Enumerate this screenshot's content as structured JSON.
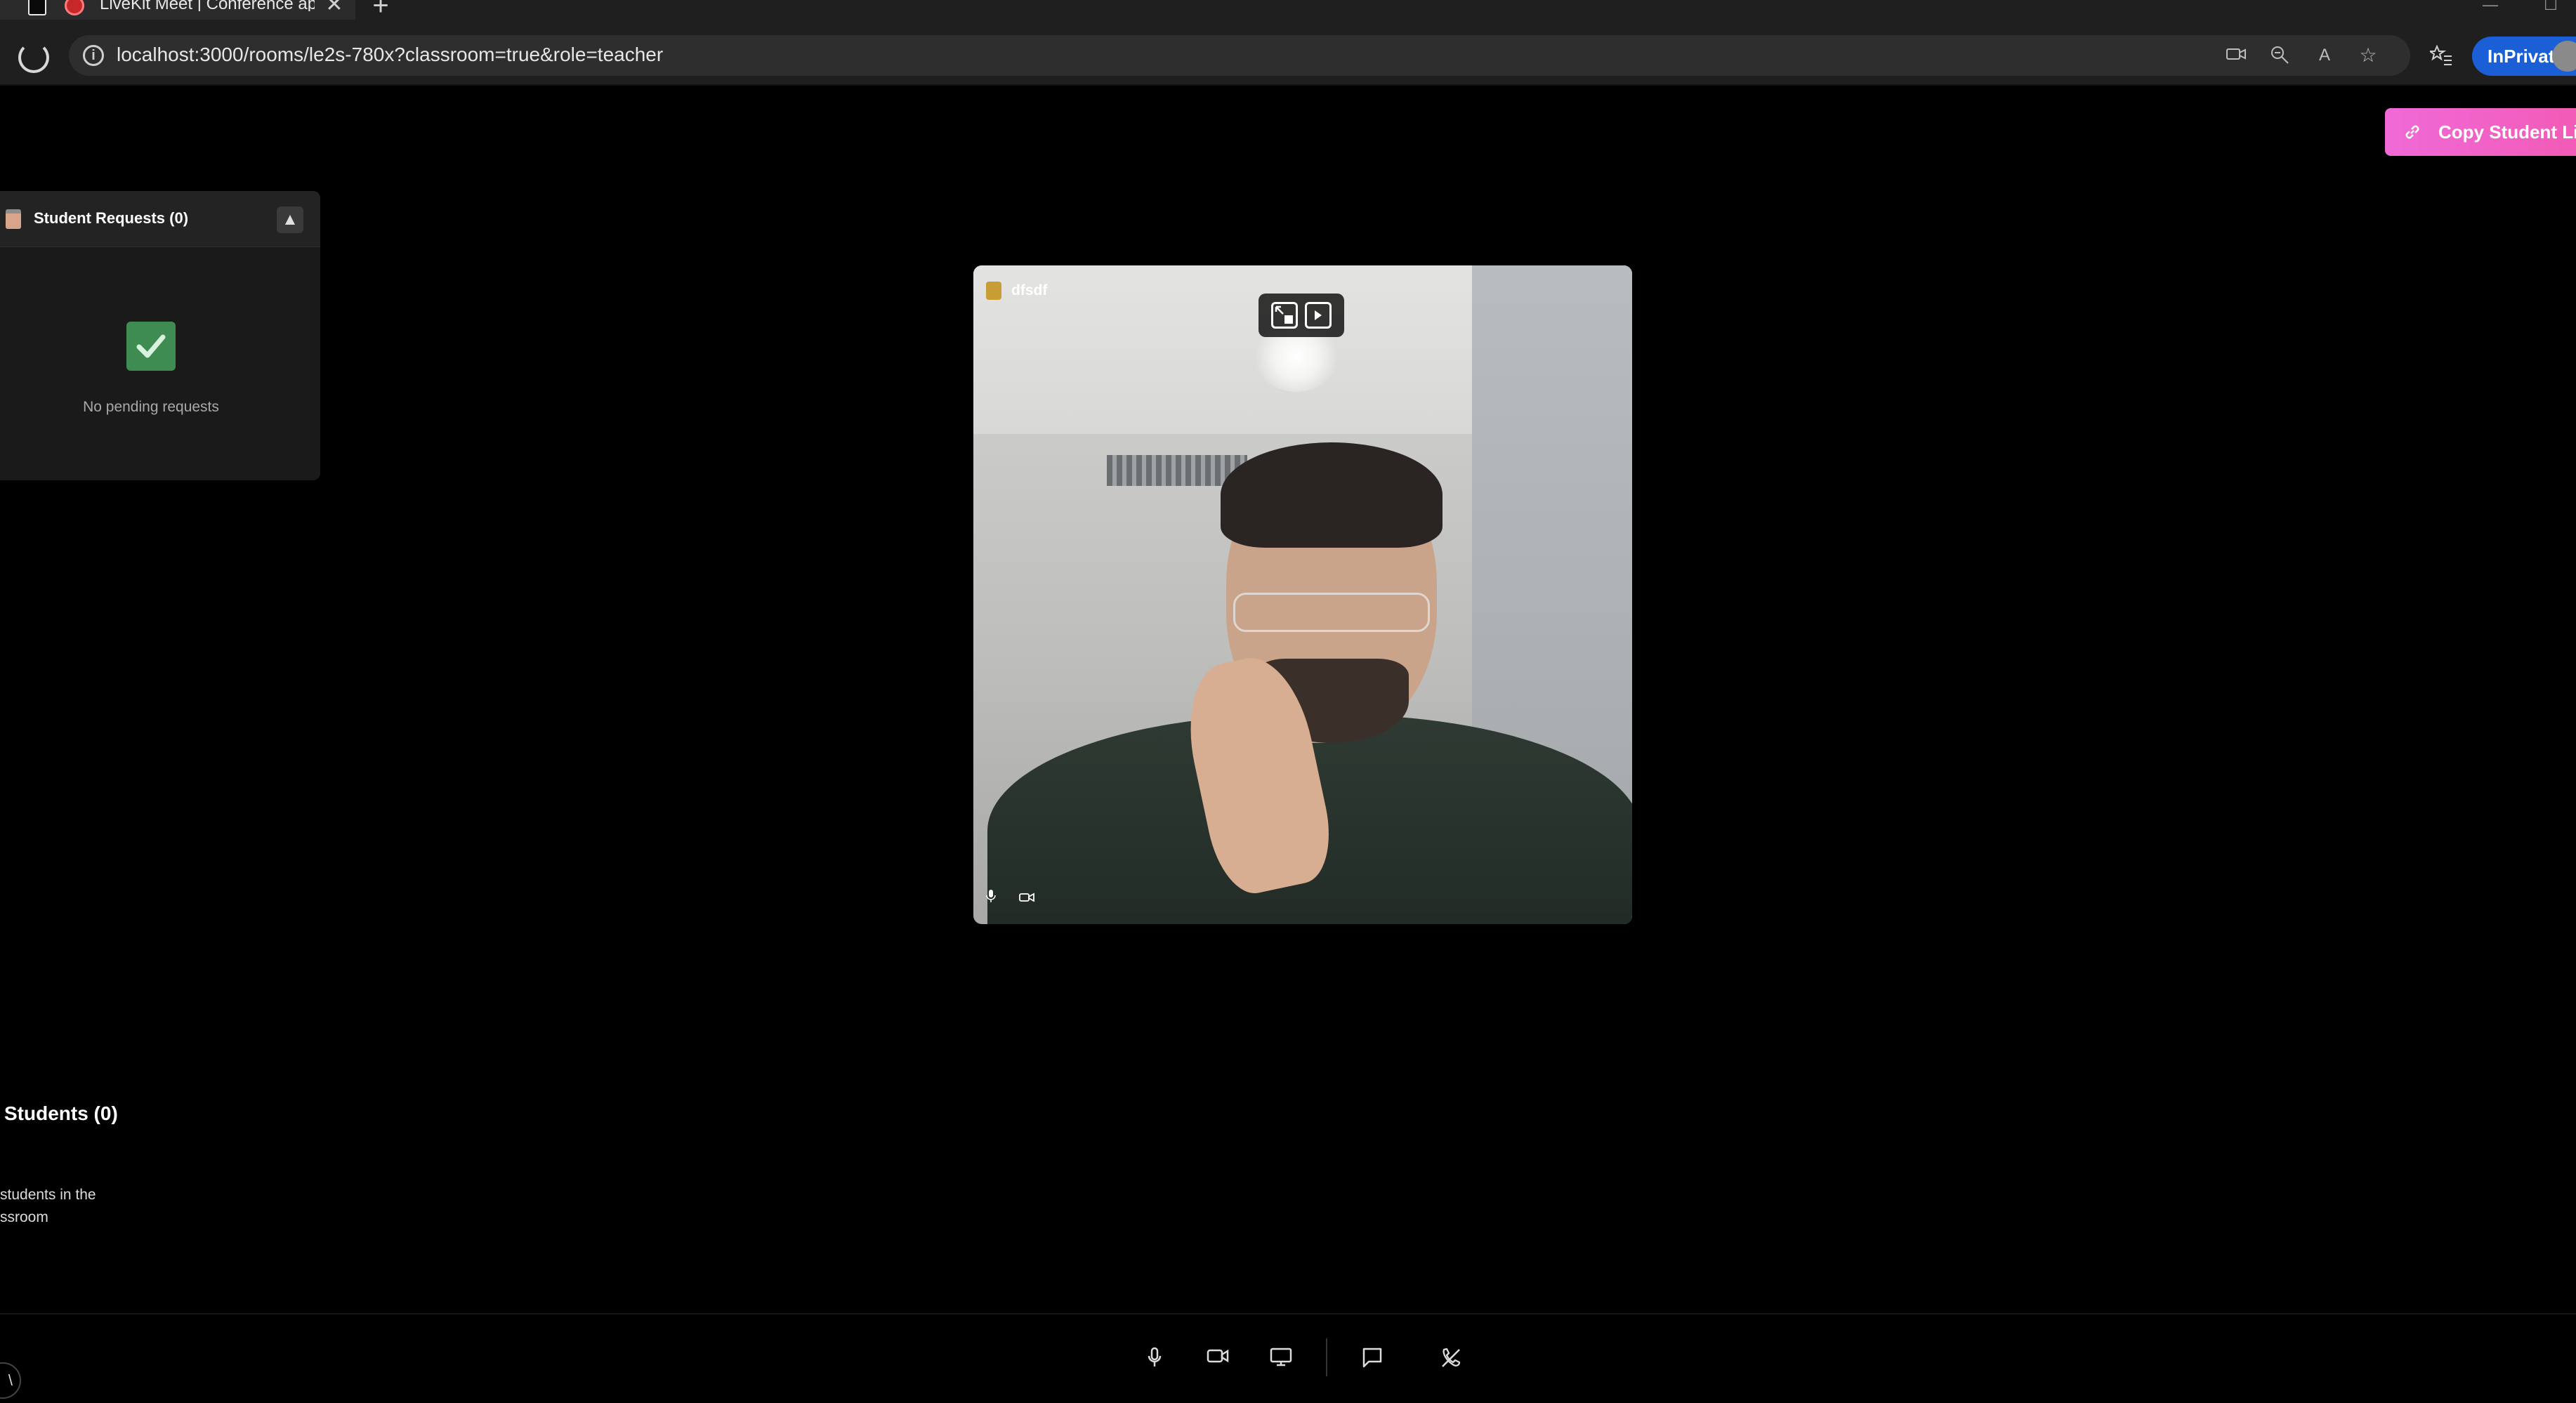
{
  "browser": {
    "tab_title": "LiveKit Meet | Conference ap",
    "url": "localhost:3000/rooms/le2s-780x?classroom=true&role=teacher",
    "inprivate_label": "InPrivate",
    "new_tab_symbol": "+",
    "close_symbol": "✕",
    "minimize_symbol": "—",
    "maximize_symbol": "☐"
  },
  "header": {
    "copy_link_label": "Copy Student Link"
  },
  "requests_panel": {
    "title": "Student Requests (0)",
    "toggle_symbol": "▲",
    "empty_text": "No pending requests"
  },
  "video": {
    "participant_name": "dfsdf",
    "mic_icon": "mic-icon",
    "camera_icon": "camera-icon"
  },
  "students": {
    "title": "Students (0)",
    "empty_line1": "students in the",
    "empty_line2": "ssroom"
  },
  "controls": {
    "items": [
      "microphone",
      "camera",
      "screen-share",
      "chat",
      "leave"
    ],
    "corner_symbol": "\\"
  },
  "colors": {
    "accent_pink": "#f06ad8",
    "inprivate_blue": "#1a5fd6",
    "success_green": "#3f8c52",
    "background": "#000000"
  }
}
